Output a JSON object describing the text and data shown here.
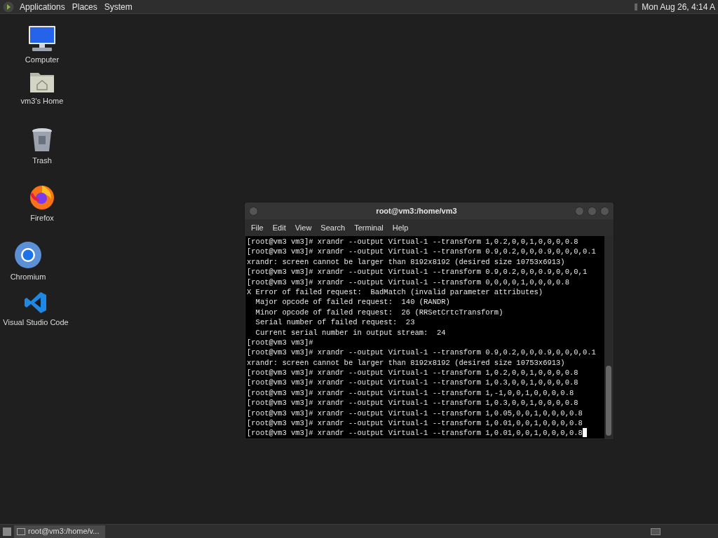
{
  "top_panel": {
    "menus": [
      "Applications",
      "Places",
      "System"
    ],
    "clock": "Mon Aug 26, 4:14 A"
  },
  "desktop_icons": [
    {
      "kind": "computer",
      "label": "Computer"
    },
    {
      "kind": "home",
      "label": "vm3's Home"
    },
    {
      "kind": "trash",
      "label": "Trash"
    },
    {
      "kind": "firefox",
      "label": "Firefox"
    },
    {
      "kind": "chromium",
      "label": "Chromium"
    },
    {
      "kind": "vscode",
      "label": "Visual Studio Code"
    }
  ],
  "terminal": {
    "title": "root@vm3:/home/vm3",
    "menu": [
      "File",
      "Edit",
      "View",
      "Search",
      "Terminal",
      "Help"
    ],
    "lines": [
      "[root@vm3 vm3]# xrandr --output Virtual-1 --transform 1,0.2,0,0,1,0,0,0,0.8",
      "[root@vm3 vm3]# xrandr --output Virtual-1 --transform 0.9,0.2,0,0,0.9,0,0,0,0.1",
      "xrandr: screen cannot be larger than 8192x8192 (desired size 10753x6913)",
      "[root@vm3 vm3]# xrandr --output Virtual-1 --transform 0.9,0.2,0,0,0.9,0,0,0,1",
      "[root@vm3 vm3]# xrandr --output Virtual-1 --transform 0,0,0,0,1,0,0,0,0.8",
      "X Error of failed request:  BadMatch (invalid parameter attributes)",
      "  Major opcode of failed request:  140 (RANDR)",
      "  Minor opcode of failed request:  26 (RRSetCrtcTransform)",
      "  Serial number of failed request:  23",
      "  Current serial number in output stream:  24",
      "[root@vm3 vm3]#",
      "[root@vm3 vm3]# xrandr --output Virtual-1 --transform 0.9,0.2,0,0,0.9,0,0,0,0.1",
      "xrandr: screen cannot be larger than 8192x8192 (desired size 10753x6913)",
      "[root@vm3 vm3]# xrandr --output Virtual-1 --transform 1,0.2,0,0,1,0,0,0,0.8",
      "[root@vm3 vm3]# xrandr --output Virtual-1 --transform 1,0.3,0,0,1,0,0,0,0.8",
      "[root@vm3 vm3]# xrandr --output Virtual-1 --transform 1,-1,0,0,1,0,0,0,0.8",
      "[root@vm3 vm3]# xrandr --output Virtual-1 --transform 1,0.3,0,0,1,0,0,0,0.8",
      "[root@vm3 vm3]# xrandr --output Virtual-1 --transform 1,0.05,0,0,1,0,0,0,0.8",
      "[root@vm3 vm3]# xrandr --output Virtual-1 --transform 1,0.01,0,0,1,0,0,0,0.8",
      "[root@vm3 vm3]# xrandr --output Virtual-1 --transform 1,0.01,0,0,1,0,0,0,0.8"
    ]
  },
  "taskbar": {
    "tasks": [
      {
        "label": "root@vm3:/home/v...",
        "selected": true
      }
    ]
  }
}
